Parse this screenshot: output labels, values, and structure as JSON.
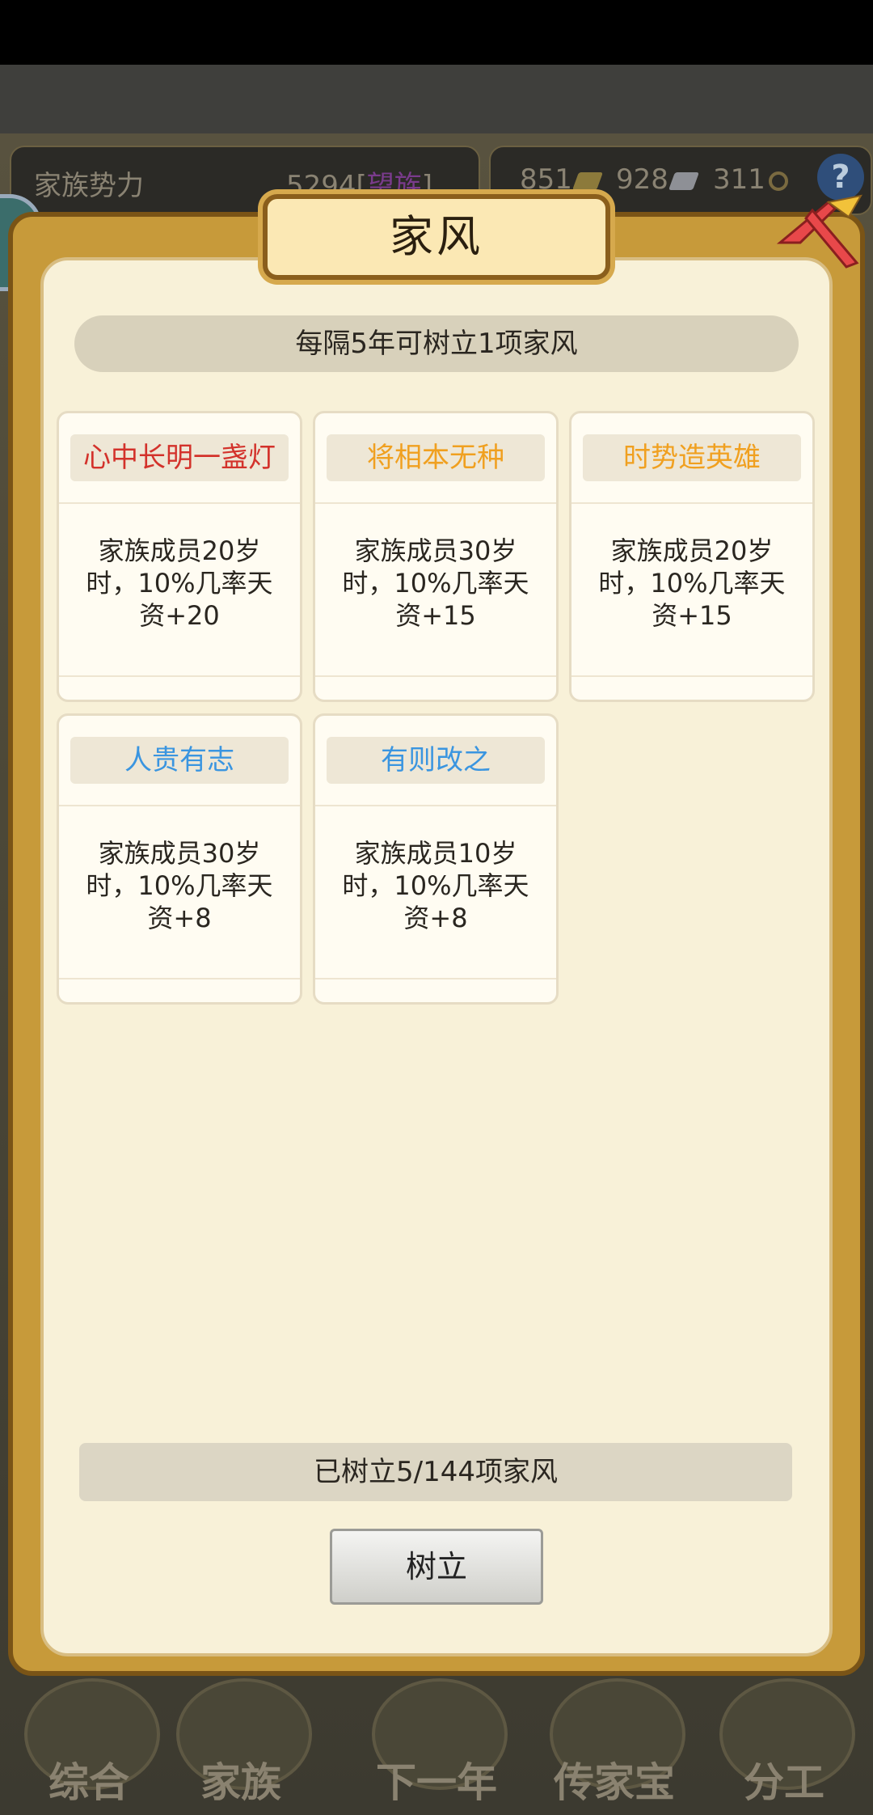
{
  "header": {
    "family_power_label": "家族势力",
    "family_power_value": "5294",
    "family_power_badge": "望族",
    "gold": "851",
    "silver": "928",
    "copper": "311",
    "help_symbol": "?"
  },
  "dialog": {
    "title": "家风",
    "info": "每隔5年可树立1项家风",
    "cards": [
      {
        "name": "心中长明一盏灯",
        "desc": "家族成员20岁时，10%几率天资+20",
        "color": "#d3322b"
      },
      {
        "name": "将相本无种",
        "desc": "家族成员30岁时，10%几率天资+15",
        "color": "#f0a020"
      },
      {
        "name": "时势造英雄",
        "desc": "家族成员20岁时，10%几率天资+15",
        "color": "#f0a020"
      },
      {
        "name": "人贵有志",
        "desc": "家族成员30岁时，10%几率天资+8",
        "color": "#3a95e0"
      },
      {
        "name": "有则改之",
        "desc": "家族成员10岁时，10%几率天资+8",
        "color": "#3a95e0"
      }
    ],
    "progress": "已树立5/144项家风",
    "establish_button": "树立"
  },
  "bottom_nav": [
    {
      "label": "综合"
    },
    {
      "label": "家族"
    },
    {
      "label": "下一年"
    },
    {
      "label": "传家宝"
    },
    {
      "label": "分工"
    }
  ]
}
